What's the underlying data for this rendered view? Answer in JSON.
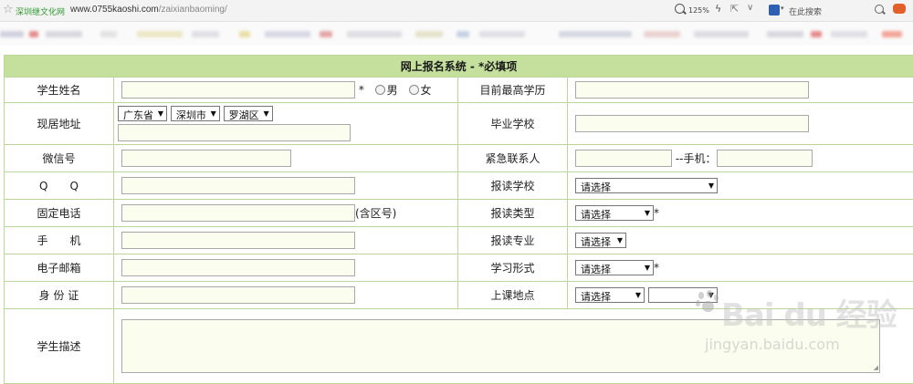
{
  "browser": {
    "site_name": "深圳继文化网",
    "url_host": "www.0755kaoshi.com",
    "url_path": "/zaixianbaoming/",
    "zoom": "125%",
    "search_placeholder": "在此搜索"
  },
  "form": {
    "title": "网上报名系统 - *必填项",
    "labels": {
      "name": "学生姓名",
      "address": "现居地址",
      "wechat": "微信号",
      "qq": "Q　　Q",
      "landline": "固定电话",
      "mobile": "手　　机",
      "email": "电子邮箱",
      "id_card": "身 份 证",
      "description": "学生描述",
      "education": "目前最高学历",
      "school_graduated": "毕业学校",
      "emergency_contact": "紧急联系人",
      "apply_school": "报读学校",
      "apply_type": "报读类型",
      "apply_major": "报读专业",
      "study_mode": "学习形式",
      "class_location": "上课地点"
    },
    "required_mark": "*",
    "gender": {
      "male": "男",
      "female": "女"
    },
    "address": {
      "province": "广东省",
      "city": "深圳市",
      "district": "罗湖区"
    },
    "landline_note": "(含区号)",
    "emergency_phone_label": "--手机：",
    "select_default": "请选择"
  },
  "watermark": {
    "brand": "Bai du 经验",
    "url": "jingyan.baidu.com"
  },
  "colors": {
    "header_bg": "#c5e09d",
    "border": "#bcd79a",
    "input_bg": "#fbfdef"
  }
}
